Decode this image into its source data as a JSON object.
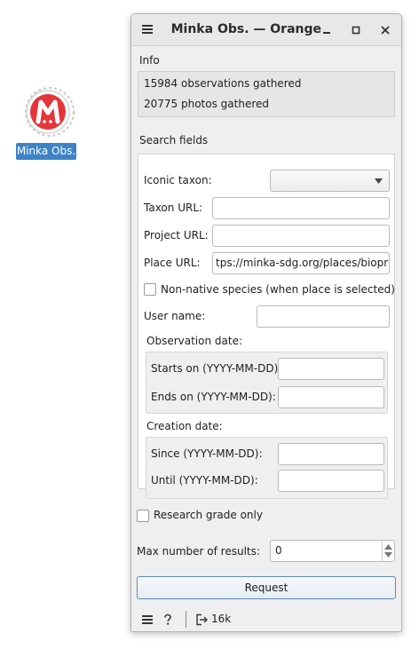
{
  "desktop": {
    "icon_label": "Minka Obs.",
    "logo_letter": "M",
    "logo_color": "#e5343a"
  },
  "window": {
    "title": "Minka Obs. — Orange",
    "menu_icon": "hamburger-icon",
    "minimize_icon": "minimize-icon",
    "maximize_icon": "maximize-icon",
    "close_icon": "close-icon"
  },
  "info": {
    "heading": "Info",
    "lines": [
      "15984 observations gathered",
      "20775 photos gathered"
    ]
  },
  "search": {
    "heading": "Search fields",
    "iconic_taxon_label": "Iconic taxon:",
    "iconic_taxon_value": "",
    "taxon_url_label": "Taxon URL:",
    "taxon_url_value": "",
    "project_url_label": "Project URL:",
    "project_url_value": "",
    "place_url_label": "Place URL:",
    "place_url_value": "tps://minka-sdg.org/places/bioprat",
    "non_native_label": "Non-native species (when place is selected)",
    "non_native_checked": false,
    "user_name_label": "User name:",
    "user_name_value": "",
    "observation_date": {
      "heading": "Observation date:",
      "starts_label": "Starts on (YYYY-MM-DD):",
      "starts_value": "",
      "ends_label": "Ends on (YYYY-MM-DD):",
      "ends_value": ""
    },
    "creation_date": {
      "heading": "Creation date:",
      "since_label": "Since (YYYY-MM-DD):",
      "since_value": "",
      "until_label": "Until (YYYY-MM-DD):",
      "until_value": ""
    }
  },
  "options": {
    "research_grade_label": "Research grade only",
    "research_grade_checked": false,
    "max_results_label": "Max number of results:",
    "max_results_value": "0"
  },
  "request_button": "Request",
  "status": {
    "menu_icon": "hamburger-icon",
    "help_icon": "help-icon",
    "output_icon": "output-icon",
    "output_count": "16k"
  },
  "colors": {
    "selection_blue": "#3c84c8",
    "button_border": "#5b8bbd",
    "window_bg": "#efefef"
  }
}
